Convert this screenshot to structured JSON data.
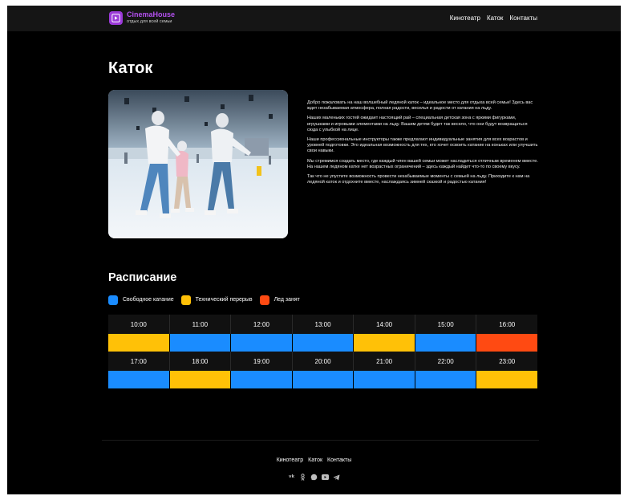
{
  "header": {
    "brand": "CinemaHouse",
    "tagline": "отдых для всей семьи",
    "nav": [
      "Кинотеатр",
      "Каток",
      "Контакты"
    ]
  },
  "page_title": "Каток",
  "intro": [
    "Добро пожаловать на наш волшебный ледяной каток – идеальное место для отдыха всей семьи! Здесь вас ждет незабываемая атмосфера, полная радости, веселья и радости от катания на льду.",
    "Наших маленьких гостей ожидает настоящий рай – специальная детская зона с яркими фигурками, игрушками и игровыми элементами на льду. Вашим детям будет так весело, что они будут возвращаться сюда с улыбкой на лице.",
    "Наши профессиональные инструкторы также предлагают индивидуальные занятия для всех возрастов и уровней подготовки. Это идеальная возможность для тех, кто хочет освоить катание на коньках или улучшить свои навыки.",
    "Мы стремимся создать место, где каждый член вашей семьи может насладиться отличным временем вместе. На нашем ледяном катке нет возрастных ограничений – здесь каждый найдет что-то по своему вкусу.",
    "Так что не упустите возможность провести незабываемые моменты с семьей на льду. Приходите к нам на ледяной каток и отдохните вместе, наслаждаясь зимней сказкой и радостью катания!"
  ],
  "schedule": {
    "title": "Расписание",
    "legend": [
      {
        "label": "Свободное катание",
        "color": "#1a8cff"
      },
      {
        "label": "Технический перерыв",
        "color": "#ffc107"
      },
      {
        "label": "Лед занят",
        "color": "#ff4a12"
      }
    ],
    "rows": [
      {
        "times": [
          "10:00",
          "11:00",
          "12:00",
          "13:00",
          "14:00",
          "15:00",
          "16:00"
        ],
        "status": [
          "break",
          "free",
          "free",
          "free",
          "break",
          "free",
          "busy"
        ]
      },
      {
        "times": [
          "17:00",
          "18:00",
          "19:00",
          "20:00",
          "21:00",
          "22:00",
          "23:00"
        ],
        "status": [
          "free",
          "break",
          "free",
          "free",
          "free",
          "free",
          "break"
        ]
      }
    ],
    "status_colors": {
      "free": "#1a8cff",
      "break": "#ffc107",
      "busy": "#ff4a12"
    }
  },
  "footer": {
    "nav": [
      "Кинотеатр",
      "Каток",
      "Контакты"
    ],
    "social_icons": [
      "vk-icon",
      "odnoklassniki-icon",
      "whatsapp-icon",
      "youtube-icon",
      "telegram-icon"
    ]
  }
}
